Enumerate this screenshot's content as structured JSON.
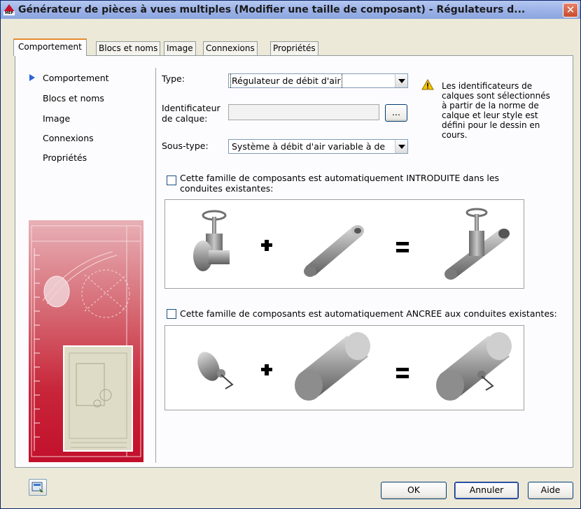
{
  "window": {
    "title": "Générateur de pièces à vues multiples (Modifier une taille de composant) - Régulateurs d...",
    "icon_label": "MEP",
    "close_glyph": "✕"
  },
  "tabs": [
    {
      "label": "Comportement",
      "active": true
    },
    {
      "label": "Blocs et noms",
      "active": false
    },
    {
      "label": "Image",
      "active": false
    },
    {
      "label": "Connexions",
      "active": false
    },
    {
      "label": "Propriétés",
      "active": false
    }
  ],
  "nav": [
    {
      "label": "Comportement",
      "selected": true
    },
    {
      "label": "Blocs et noms",
      "selected": false
    },
    {
      "label": "Image",
      "selected": false
    },
    {
      "label": "Connexions",
      "selected": false
    },
    {
      "label": "Propriétés",
      "selected": false
    }
  ],
  "form": {
    "type_label": "Type:",
    "type_value": "Régulateur de débit d'air",
    "layer_label_1": "Identificateur",
    "layer_label_2": "de calque:",
    "layer_value": "",
    "browse_label": "...",
    "subtype_label": "Sous-type:",
    "subtype_value": "Système à débit d'air variable à de",
    "warning": "Les identificateurs de calques sont sélectionnés à partir de la norme de calque et leur style est défini pour le dessin en cours."
  },
  "options": {
    "insert_label_1": "Cette famille de composants est automatiquement INTRODUITE dans les",
    "insert_label_2": "conduites existantes:",
    "insert_checked": false,
    "anchor_label": "Cette famille de composants est automatiquement ANCREE aux conduites existantes:",
    "anchor_checked": false
  },
  "illustration": {
    "plus": "+",
    "equals": "="
  },
  "footer": {
    "ok": "OK",
    "cancel": "Annuler",
    "help": "Aide"
  },
  "colors": {
    "accent_tab": "#e68b2c",
    "art_red": "#c20f2b",
    "selector_blue": "#2c63d6"
  }
}
